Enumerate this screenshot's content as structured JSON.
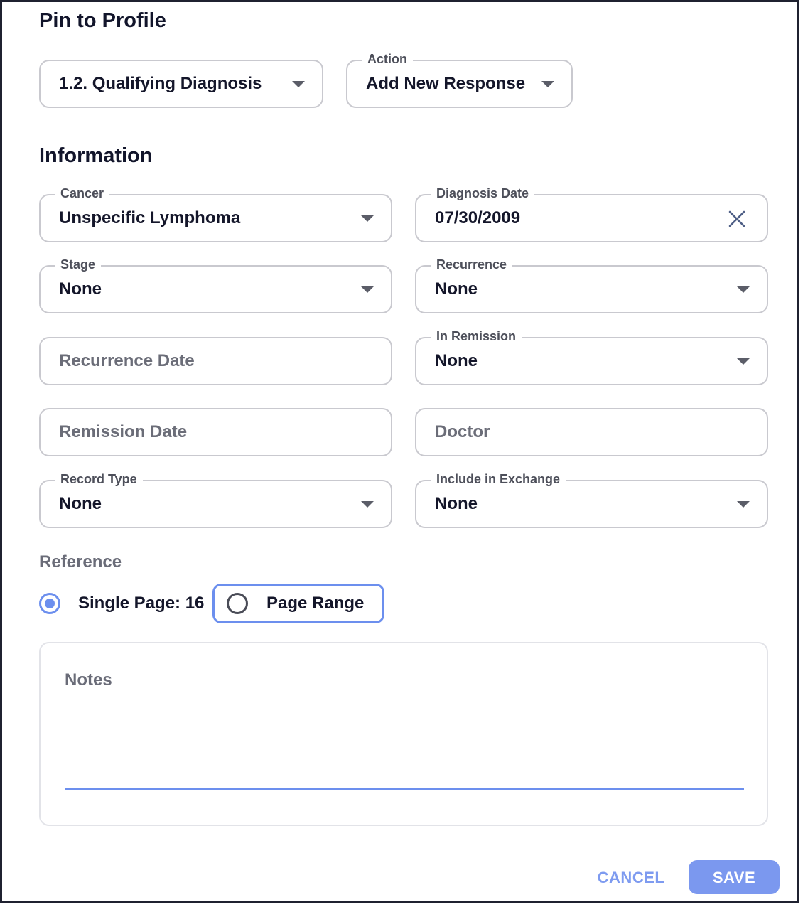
{
  "dialog": {
    "title": "Pin to Profile"
  },
  "pin": {
    "section": {
      "value": "1.2. Qualifying Diagnosis"
    },
    "action": {
      "label": "Action",
      "value": "Add New Response"
    }
  },
  "information": {
    "title": "Information",
    "cancer": {
      "label": "Cancer",
      "value": "Unspecific Lymphoma"
    },
    "diagnosis_date": {
      "label": "Diagnosis Date",
      "value": "07/30/2009"
    },
    "stage": {
      "label": "Stage",
      "value": "None"
    },
    "recurrence": {
      "label": "Recurrence",
      "value": "None"
    },
    "recurrence_date": {
      "placeholder": "Recurrence Date"
    },
    "in_remission": {
      "label": "In Remission",
      "value": "None"
    },
    "remission_date": {
      "placeholder": "Remission Date"
    },
    "doctor": {
      "placeholder": "Doctor"
    },
    "record_type": {
      "label": "Record Type",
      "value": "None"
    },
    "include_in_exchange": {
      "label": "Include in Exchange",
      "value": "None"
    }
  },
  "reference": {
    "title": "Reference",
    "options": [
      {
        "label": "Single Page: 16",
        "selected": true
      },
      {
        "label": "Page Range",
        "selected": false
      }
    ]
  },
  "notes": {
    "placeholder": "Notes"
  },
  "actions": {
    "cancel_label": "CANCEL",
    "save_label": "SAVE"
  },
  "colors": {
    "accent": "#6c8fee",
    "save_bg": "#7b98ef",
    "heading": "#12152b",
    "border": "#c9c9cf"
  },
  "icons": {
    "dropdown": "caret-down-icon",
    "clear": "close-icon",
    "radio_on": "radio-checked-icon",
    "radio_off": "radio-unchecked-icon"
  }
}
